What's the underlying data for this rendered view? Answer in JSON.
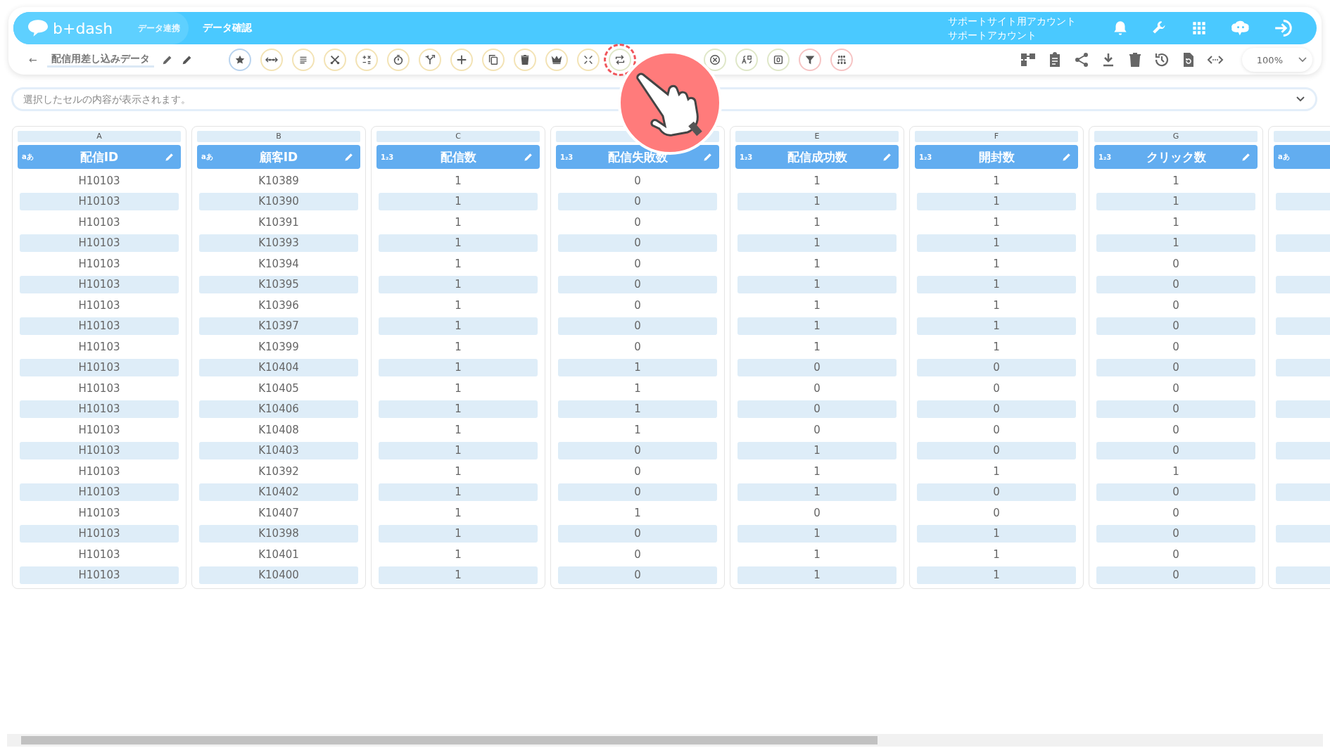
{
  "header": {
    "logo": "b+dash",
    "section": "データ連携",
    "page_title": "データ確認",
    "account_line_1": "サポートサイト用アカウント",
    "account_line_2": "サポートアカウント"
  },
  "toolbar": {
    "back": "←",
    "data_name": "配信用差し込みデータ",
    "tools": [
      {
        "kind": "star",
        "color": "#b9d3ee",
        "highlighted": false
      },
      {
        "kind": "dots",
        "color": "#f3e3b5",
        "highlighted": false
      },
      {
        "kind": "lines",
        "color": "#f3e3b5",
        "highlighted": false
      },
      {
        "kind": "scissors",
        "color": "#f3e3b5",
        "highlighted": false
      },
      {
        "kind": "calc",
        "color": "#f3e3b5",
        "highlighted": false
      },
      {
        "kind": "timer",
        "color": "#f3e3b5",
        "highlighted": false
      },
      {
        "kind": "branch",
        "color": "#f3e3b5",
        "highlighted": false
      },
      {
        "kind": "plus",
        "color": "#f3e3b5",
        "highlighted": false
      },
      {
        "kind": "copy",
        "color": "#f3e3b5",
        "highlighted": false
      },
      {
        "kind": "trash",
        "color": "#f3e3b5",
        "highlighted": false
      },
      {
        "kind": "crown",
        "color": "#f3e3b5",
        "highlighted": false
      },
      {
        "kind": "compress",
        "color": "#f3e3b5",
        "highlighted": false
      },
      {
        "kind": "swap",
        "color": "#dfe7c8",
        "highlighted": true
      },
      {
        "kind": "close",
        "color": "#dfe7c8",
        "highlighted": false
      },
      {
        "kind": "translate",
        "color": "#dfe7c8",
        "highlighted": false
      },
      {
        "kind": "zero",
        "color": "#dfe7c8",
        "highlighted": false
      },
      {
        "kind": "filter",
        "color": "#f6c4c4",
        "highlighted": false
      },
      {
        "kind": "group",
        "color": "#f6c4c4",
        "highlighted": false
      }
    ],
    "zoom": "100%"
  },
  "cell_bar": {
    "placeholder": "選択したセルの内容が表示されます。"
  },
  "columns": [
    {
      "letter": "A",
      "type_label": "aあ",
      "name": "配信ID",
      "cells": [
        "H10103",
        "H10103",
        "H10103",
        "H10103",
        "H10103",
        "H10103",
        "H10103",
        "H10103",
        "H10103",
        "H10103",
        "H10103",
        "H10103",
        "H10103",
        "H10103",
        "H10103",
        "H10103",
        "H10103",
        "H10103",
        "H10103",
        "H10103"
      ]
    },
    {
      "letter": "B",
      "type_label": "aあ",
      "name": "顧客ID",
      "cells": [
        "K10389",
        "K10390",
        "K10391",
        "K10393",
        "K10394",
        "K10395",
        "K10396",
        "K10397",
        "K10399",
        "K10404",
        "K10405",
        "K10406",
        "K10408",
        "K10403",
        "K10392",
        "K10402",
        "K10407",
        "K10398",
        "K10401",
        "K10400"
      ]
    },
    {
      "letter": "C",
      "type_label": "1₂3",
      "name": "配信数",
      "cells": [
        "1",
        "1",
        "1",
        "1",
        "1",
        "1",
        "1",
        "1",
        "1",
        "1",
        "1",
        "1",
        "1",
        "1",
        "1",
        "1",
        "1",
        "1",
        "1",
        "1"
      ]
    },
    {
      "type_label": "1₂3",
      "name": "配信失敗数",
      "cells": [
        "0",
        "0",
        "0",
        "0",
        "0",
        "0",
        "0",
        "0",
        "0",
        "1",
        "1",
        "1",
        "1",
        "0",
        "0",
        "0",
        "1",
        "0",
        "0",
        "0"
      ]
    },
    {
      "letter": "E",
      "type_label": "1₂3",
      "name": "配信成功数",
      "cells": [
        "1",
        "1",
        "1",
        "1",
        "1",
        "1",
        "1",
        "1",
        "1",
        "0",
        "0",
        "0",
        "0",
        "1",
        "1",
        "1",
        "0",
        "1",
        "1",
        "1"
      ]
    },
    {
      "letter": "F",
      "type_label": "1₂3",
      "name": "開封数",
      "cells": [
        "1",
        "1",
        "1",
        "1",
        "1",
        "1",
        "1",
        "1",
        "1",
        "0",
        "0",
        "0",
        "0",
        "0",
        "1",
        "0",
        "0",
        "1",
        "1",
        "1"
      ]
    },
    {
      "letter": "G",
      "type_label": "1₂3",
      "name": "クリック数",
      "cells": [
        "1",
        "1",
        "1",
        "1",
        "0",
        "0",
        "0",
        "0",
        "0",
        "0",
        "0",
        "0",
        "0",
        "0",
        "1",
        "0",
        "0",
        "0",
        "0",
        "0"
      ]
    },
    {
      "type_label": "aあ",
      "cells": [
        "",
        "",
        "",
        "",
        "",
        "",
        "",
        "",
        "",
        "",
        "",
        "",
        "",
        "",
        "",
        "",
        "",
        "",
        "",
        ""
      ]
    }
  ]
}
